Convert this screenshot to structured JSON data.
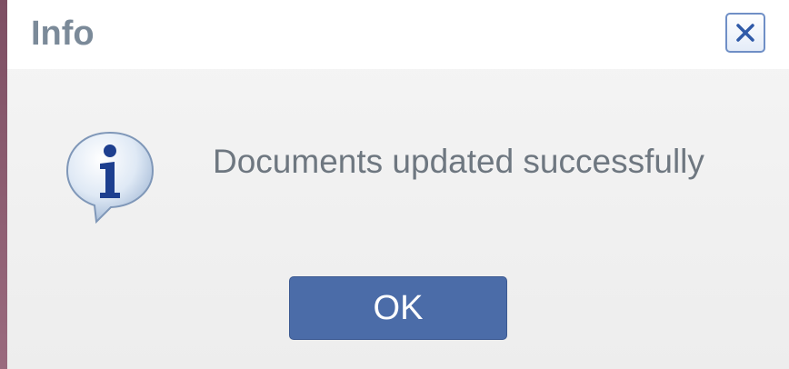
{
  "dialog": {
    "title": "Info",
    "close_icon": "close-icon",
    "message_icon": "info-icon",
    "message": "Documents updated successfully",
    "ok_label": "OK"
  },
  "colors": {
    "title_text": "#7b8a99",
    "message_text": "#6e7780",
    "ok_button_bg": "#4b6ca8",
    "close_button_border": "#6f8fc6",
    "info_icon_letter": "#1d3f8f"
  }
}
